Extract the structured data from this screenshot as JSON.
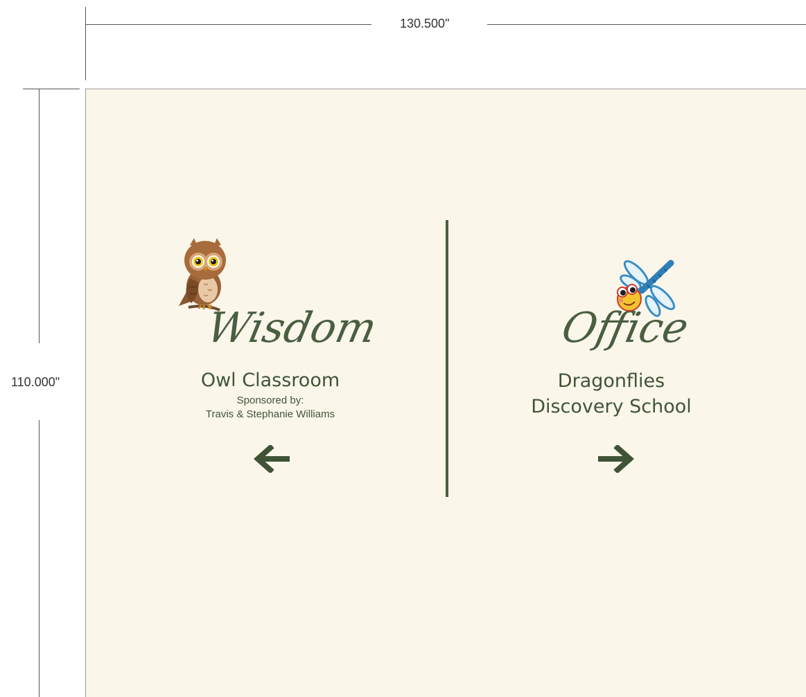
{
  "dimensions": {
    "width_label": "130.500\"",
    "height_label": "110.000\""
  },
  "left_panel": {
    "script_word": "Wisdom",
    "title": "Owl Classroom",
    "sponsor_label": "Sponsored by:",
    "sponsor_names": "Travis & Stephanie Williams",
    "arrow": "arrow-left-icon",
    "illustration": "owl-icon"
  },
  "right_panel": {
    "script_word": "Office",
    "title_line1": "Dragonflies",
    "title_line2": "Discovery School",
    "arrow": "arrow-right-icon",
    "illustration": "dragonfly-icon"
  },
  "colors": {
    "wall": "#faf6ea",
    "accent_green": "#4a5e40"
  }
}
